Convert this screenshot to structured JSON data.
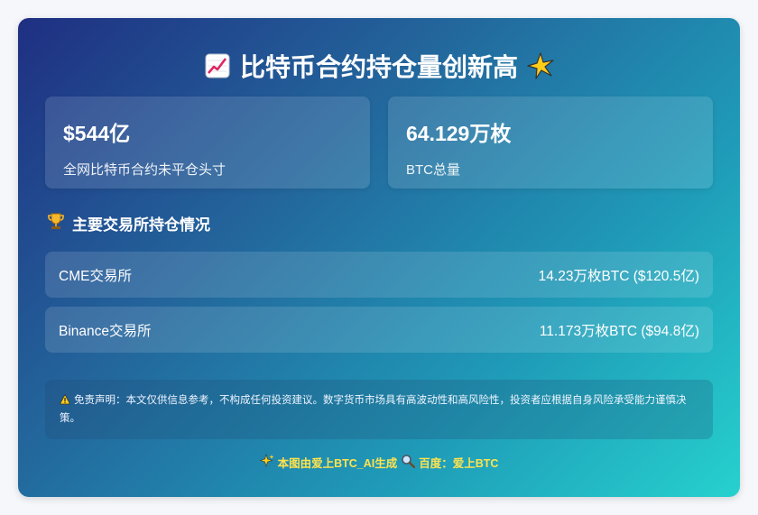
{
  "header": {
    "title": "比特币合约持仓量创新高"
  },
  "stats": [
    {
      "value": "$544亿",
      "label": "全网比特币合约未平仓头寸"
    },
    {
      "value": "64.129万枚",
      "label": "BTC总量"
    }
  ],
  "section": {
    "title": "主要交易所持仓情况"
  },
  "exchanges": [
    {
      "name": "CME交易所",
      "holding": "14.23万枚BTC ($120.5亿)"
    },
    {
      "name": "Binance交易所",
      "holding": "11.173万枚BTC ($94.8亿)"
    }
  ],
  "disclaimer": {
    "text": "免责声明：本文仅供信息参考，不构成任何投资建议。数字货币市场具有高波动性和高风险性，投资者应根据自身风险承受能力谨慎决策。"
  },
  "footer": {
    "generated": "本图由爱上BTC_AI生成",
    "search": "百度：爱上BTC"
  },
  "icons": {
    "title_left": "chart-increasing-icon",
    "title_right": "sparkle-star-icon",
    "section": "trophy-icon",
    "disclaimer": "warning-icon",
    "footer_left": "sparkles-icon",
    "footer_search": "magnifier-icon"
  },
  "colors": {
    "footer_text": "#ffe34d",
    "gradient_start": "#1f2f82",
    "gradient_end": "#26d1ce"
  }
}
